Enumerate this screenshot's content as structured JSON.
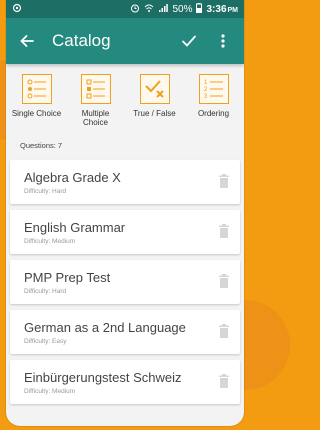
{
  "status": {
    "battery": "50%",
    "time": "3:36",
    "ampm": "PM"
  },
  "app_bar": {
    "title": "Catalog",
    "back_icon": "arrow-left-icon",
    "confirm_icon": "check-icon",
    "menu_icon": "more-vert-icon"
  },
  "question_types": [
    {
      "label": "Single Choice",
      "icon": "single-choice-icon"
    },
    {
      "label": "Multiple\nChoice",
      "icon": "multiple-choice-icon"
    },
    {
      "label": "True / False",
      "icon": "true-false-icon"
    },
    {
      "label": "Ordering",
      "icon": "ordering-icon"
    }
  ],
  "questions_count": "Questions: 7",
  "catalogs": [
    {
      "title": "Algebra Grade X",
      "difficulty": "Difficulty: Hard"
    },
    {
      "title": "English Grammar",
      "difficulty": "Difficulty: Medium"
    },
    {
      "title": "PMP Prep Test",
      "difficulty": "Difficulty: Hard"
    },
    {
      "title": "German as a 2nd Language",
      "difficulty": "Difficulty: Easy"
    },
    {
      "title": "Einbürgerungstest Schweiz",
      "difficulty": "Difficulty: Medium"
    }
  ],
  "colors": {
    "primary": "#24897e",
    "primary_dark": "#1d6f66",
    "accent": "#f0a020",
    "background": "#f39c12"
  }
}
